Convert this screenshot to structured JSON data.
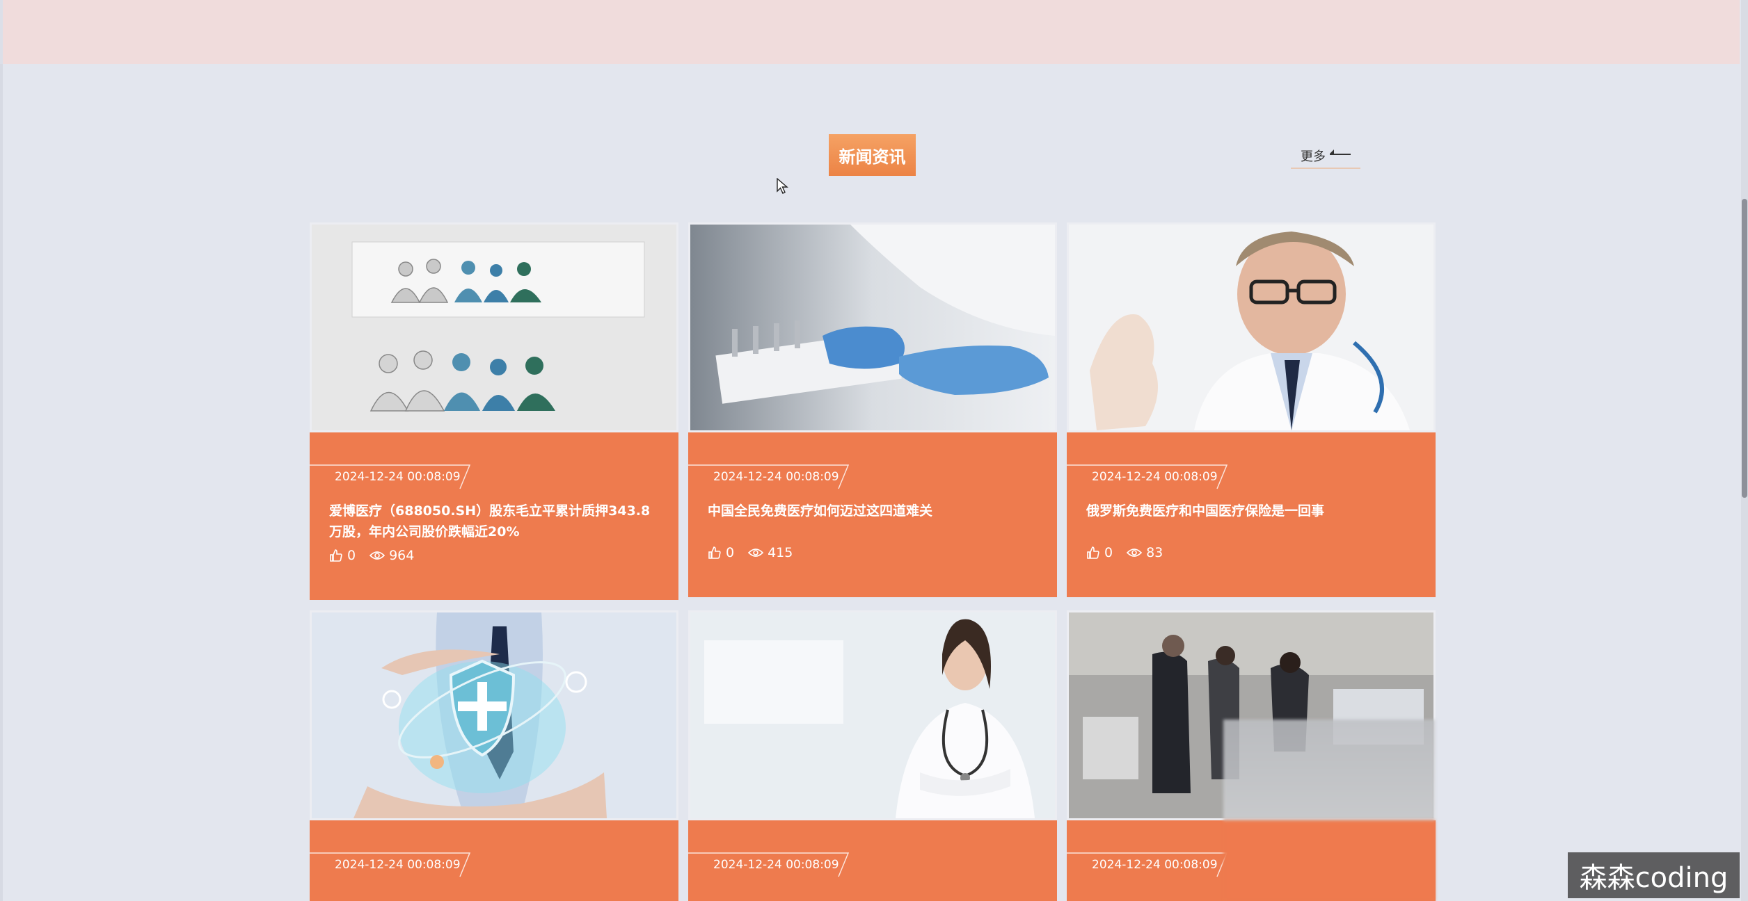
{
  "section": {
    "title": "新闻资讯",
    "more_label": "更多"
  },
  "colors": {
    "accent": "#ee7b4e",
    "title_gradient_top": "#f5a264",
    "banner": "#f0dcdc",
    "background": "#e3e6ee"
  },
  "news": [
    {
      "date": "2024-12-24 00:08:09",
      "title": "爱博医疗（688050.SH）股东毛立平累计质押343.8万股，年内公司股价跌幅近20%",
      "likes": "0",
      "views": "964",
      "image": "medical-staff-illustration"
    },
    {
      "date": "2024-12-24 00:08:09",
      "title": "中国全民免费医疗如何迈过这四道难关",
      "likes": "0",
      "views": "415",
      "image": "gloved-hands-lab-tray"
    },
    {
      "date": "2024-12-24 00:08:09",
      "title": "俄罗斯免费医疗和中国医疗保险是一回事",
      "likes": "0",
      "views": "83",
      "image": "doctor-with-glasses"
    },
    {
      "date": "2024-12-24 00:08:09",
      "title": "",
      "likes": "",
      "views": "",
      "image": "health-shield-hands"
    },
    {
      "date": "2024-12-24 00:08:09",
      "title": "",
      "likes": "",
      "views": "",
      "image": "female-doctor"
    },
    {
      "date": "2024-12-24 00:08:09",
      "title": "",
      "likes": "",
      "views": "",
      "image": "hall-visitors"
    }
  ],
  "watermark": "森森coding"
}
